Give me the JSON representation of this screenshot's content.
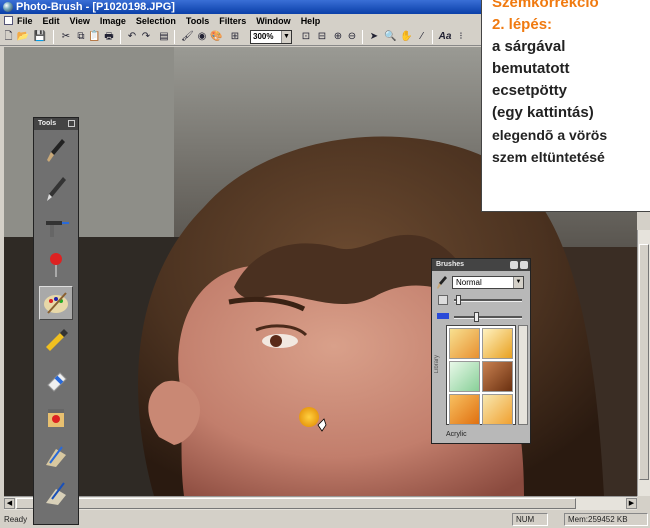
{
  "window": {
    "title": "Photo-Brush - [P1020198.JPG]"
  },
  "menu": [
    "File",
    "Edit",
    "View",
    "Image",
    "Selection",
    "Tools",
    "Filters",
    "Window",
    "Help"
  ],
  "toolbar": {
    "zoom_value": "300%"
  },
  "tools_panel": {
    "title": "Tools",
    "tools": [
      "brush-tool-icon",
      "pen-tool-icon",
      "airbrush-tool-icon",
      "pushpin-tool-icon",
      "palette-tool-icon",
      "paint-tube-tool-icon",
      "eraser-tool-icon",
      "paint-jar-tool-icon",
      "brush-set-tool-icon",
      "sprayer-tool-icon"
    ],
    "active_index": 4
  },
  "brushes_panel": {
    "title": "Brushes",
    "mode": "Normal",
    "library_label": "Library",
    "preset_name": "Acrylic"
  },
  "status": {
    "left": "Ready",
    "num": "NUM",
    "memory": "Mem:259452 KB"
  },
  "callout": {
    "heading": "Szemkorrekció",
    "step": "2. lépés:",
    "lines": [
      "a sárgával",
      "bemutatott",
      "ecsetpötty",
      "(egy kattintás)",
      "elegendõ a vörös",
      "szem eltüntetésé"
    ]
  },
  "colors": {
    "accent": "#f07a10",
    "title_bar": "#0a3fa8",
    "brush_dot": "#f0b020"
  }
}
